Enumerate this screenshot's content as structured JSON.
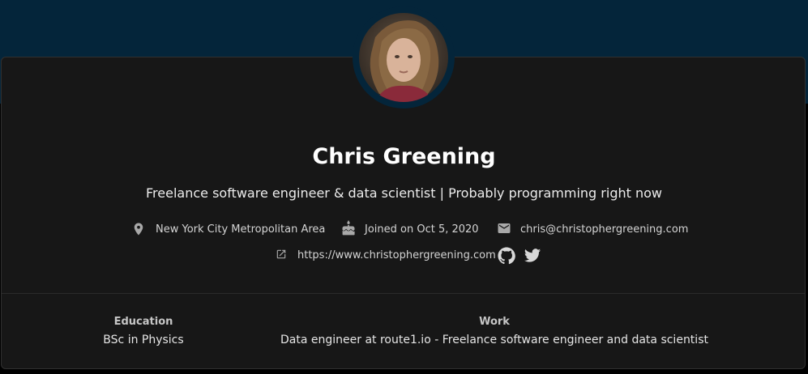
{
  "profile": {
    "name": "Chris Greening",
    "bio": "Freelance software engineer & data scientist | Probably programming right now",
    "location": "New York City Metropolitan Area",
    "joined": "Joined on Oct 5, 2020",
    "email": "chris@christophergreening.com",
    "website": "https://www.christophergreening.com"
  },
  "details": {
    "education_label": "Education",
    "education_value": "BSc in Physics",
    "work_label": "Work",
    "work_value": "Data engineer at route1.io - Freelance software engineer and data scientist"
  },
  "icons": {
    "location": "map-pin-icon",
    "joined": "cake-icon",
    "email": "mail-icon",
    "website": "external-link-icon",
    "github": "github-icon",
    "twitter": "twitter-icon"
  },
  "colors": {
    "banner": "#04253a",
    "card": "#171717",
    "text": "#ffffff"
  }
}
